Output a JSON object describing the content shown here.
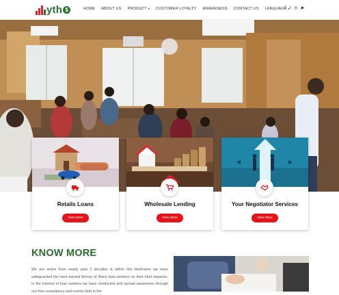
{
  "header": {
    "logo_text": "yth",
    "logo_coin": "$",
    "nav": [
      {
        "label": "HOME",
        "dropdown": false
      },
      {
        "label": "ABOUT US",
        "dropdown": false
      },
      {
        "label": "PRODUCT",
        "dropdown": true
      },
      {
        "label": "CUSTOMER LOYALTY",
        "dropdown": false
      },
      {
        "label": "AWARENESS",
        "dropdown": false
      },
      {
        "label": "CONTACT US",
        "dropdown": false
      },
      {
        "label": "LANGUAGE",
        "dropdown": true
      }
    ],
    "social": [
      "f",
      "t",
      "◎",
      "▶"
    ]
  },
  "cards": [
    {
      "title": "Retails Loans",
      "button": "View More",
      "icon": "truck-icon"
    },
    {
      "title": "Wholesale Lending",
      "button": "View More",
      "icon": "cart-icon"
    },
    {
      "title": "Your Negotiator Services",
      "button": "View More",
      "icon": "handshake-icon"
    }
  ],
  "about": {
    "title": "KNOW MORE",
    "text": "We are active from nearly past 2 decades & within this timeframe we have safeguarded the hard earned Money of Many loan-seekers on their kind requests. In the interest of loan seekers we have conducted and spread awareness through our free consultancy and events held in the"
  },
  "colors": {
    "brand_green": "#2b6a33",
    "brand_red": "#e4141c"
  }
}
